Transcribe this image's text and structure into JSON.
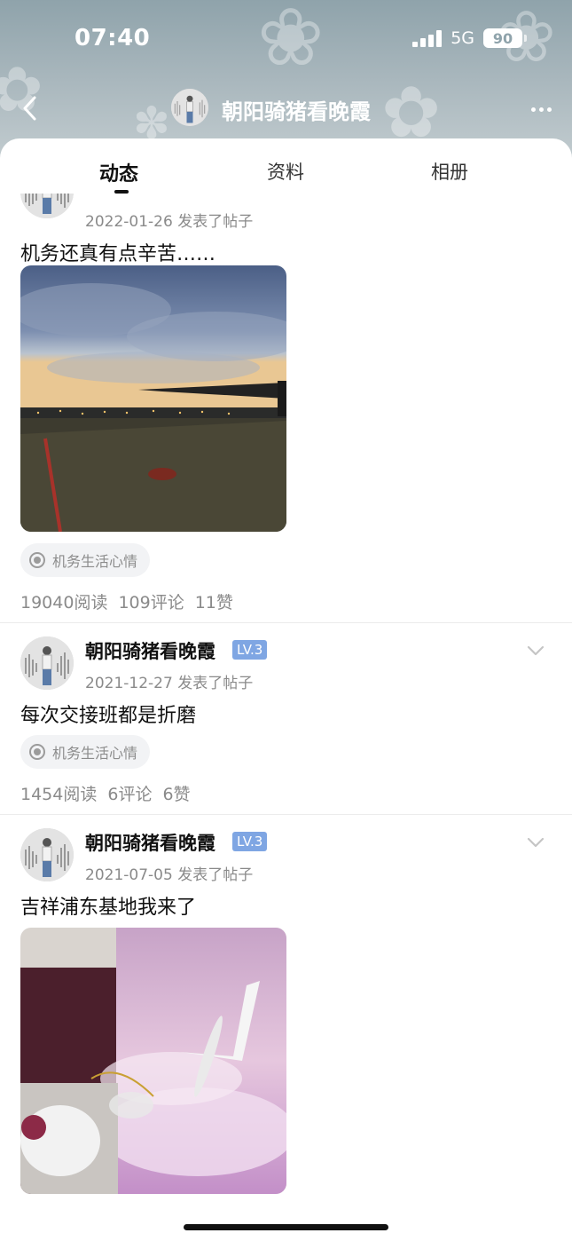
{
  "status_bar": {
    "time": "07:40",
    "network": "5G",
    "battery": "90"
  },
  "nav": {
    "title": "朝阳骑猪看晚霞",
    "back_icon": "chevron-left-icon",
    "more_icon": "more-dots-icon"
  },
  "tabs": [
    {
      "label": "动态",
      "active": true
    },
    {
      "label": "资料",
      "active": false
    },
    {
      "label": "相册",
      "active": false
    }
  ],
  "posts": [
    {
      "meta": "2022-01-26 发表了帖子",
      "content": "机务还真有点辛苦……",
      "tag": "机务生活心情",
      "reads": "19040阅读",
      "comments": "109评论",
      "likes": "11赞"
    },
    {
      "username": "朝阳骑猪看晚霞",
      "level": "LV.3",
      "meta": "2021-12-27 发表了帖子",
      "content": "每次交接班都是折磨",
      "tag": "机务生活心情",
      "reads": "1454阅读",
      "comments": "6评论",
      "likes": "6赞"
    },
    {
      "username": "朝阳骑猪看晚霞",
      "level": "LV.3",
      "meta": "2021-07-05 发表了帖子",
      "content": "吉祥浦东基地我来了"
    }
  ],
  "colors": {
    "accent_level": "#7fa6e3",
    "header_bg": "#a9b7bd"
  }
}
